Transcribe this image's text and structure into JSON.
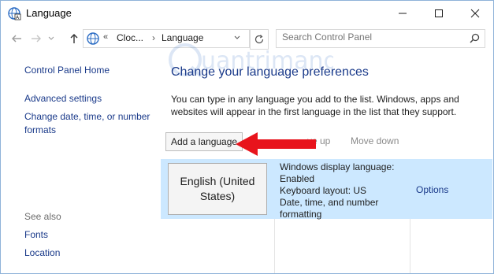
{
  "window": {
    "title": "Language"
  },
  "address": {
    "chevron": "«",
    "crumbs": [
      "Cloc...",
      "Language"
    ],
    "separator": "›"
  },
  "search": {
    "placeholder": "Search Control Panel"
  },
  "sidebar": {
    "home": "Control Panel Home",
    "links": [
      "Advanced settings",
      "Change date, time, or number formats"
    ],
    "see_also_label": "See also",
    "see_also": [
      "Fonts",
      "Location"
    ]
  },
  "main": {
    "heading": "Change your language preferences",
    "description": "You can type in any language you add to the list. Windows, apps and websites will appear in the first language in the list that they support."
  },
  "toolbar": {
    "add": "Add a language",
    "move_up": "Move up",
    "move_up_visible": "ve up",
    "move_down": "Move down"
  },
  "languages": [
    {
      "name": "English (United States)",
      "details": [
        "Windows display language: Enabled",
        "Keyboard layout: US",
        "Date, time, and number formatting"
      ],
      "options": "Options"
    }
  ],
  "watermark": {
    "text": "uantrimang"
  },
  "colors": {
    "link": "#1a3a8a",
    "selection": "#cce8ff",
    "arrow": "#e8141c"
  }
}
